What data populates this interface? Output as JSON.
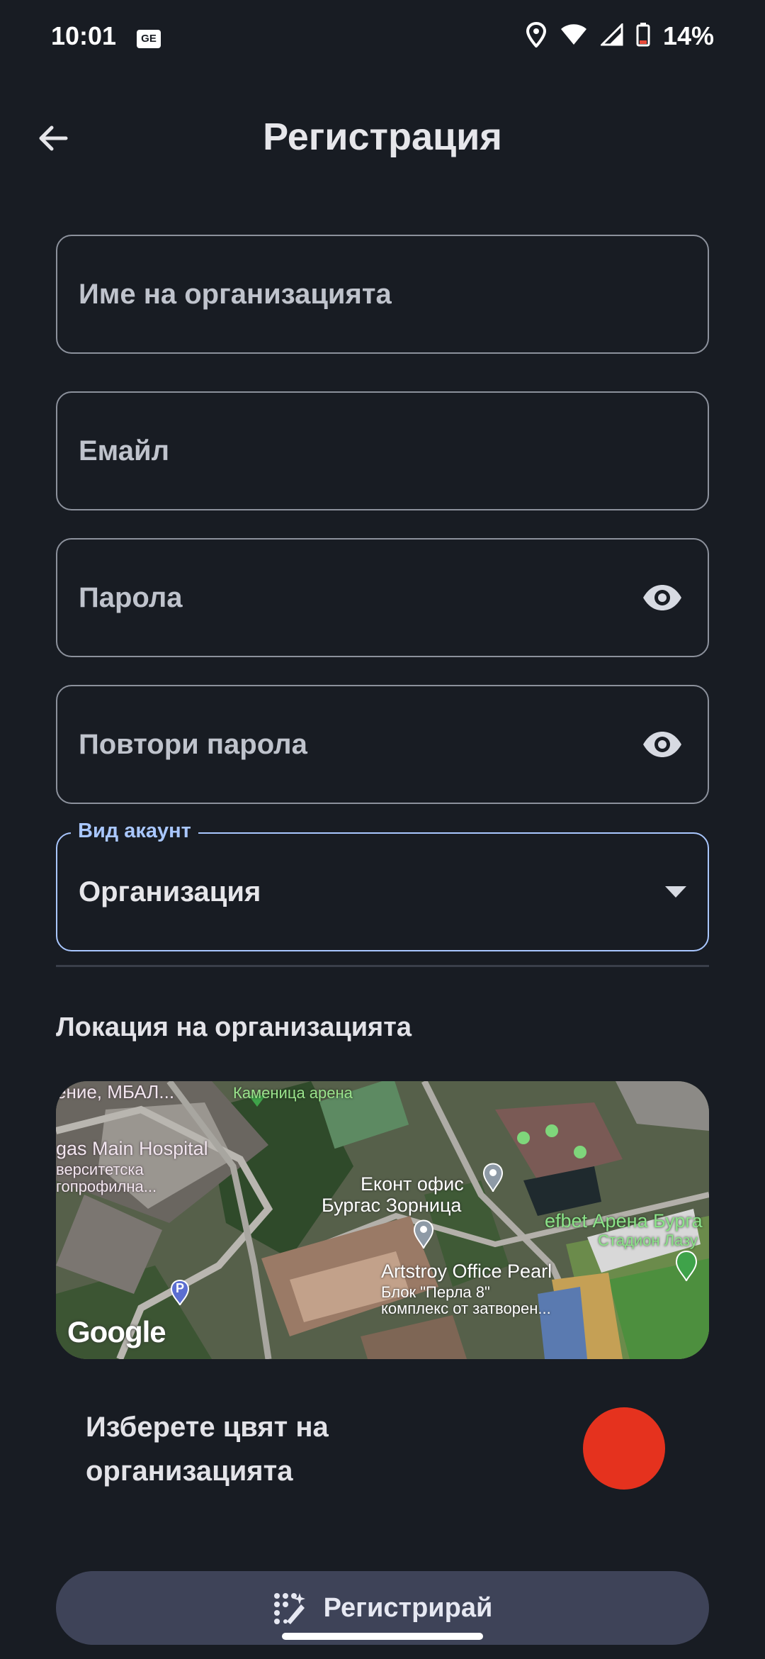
{
  "status_bar": {
    "time": "10:01",
    "ge_badge": "GE",
    "battery_percent": "14%",
    "icons": [
      "location-icon",
      "wifi-icon",
      "signal-icon",
      "battery-icon"
    ]
  },
  "header": {
    "title": "Регистрация",
    "back_icon": "arrow-left-icon"
  },
  "form": {
    "organization_name_placeholder": "Име на организацията",
    "email_placeholder": "Емайл",
    "password_placeholder": "Парола",
    "repeat_password_placeholder": "Повтори парола",
    "account_type_label": "Вид акаунт",
    "account_type_value": "Организация"
  },
  "location": {
    "title": "Локация на организацията",
    "map_labels": {
      "hospital_1": "ение, МБАЛ...",
      "hospital_2": "gas Main Hospital",
      "hospital_3": "верситетска",
      "hospital_4": "гопрофилна...",
      "arena_top": "Каменица арена",
      "econt_1": "Еконт офис",
      "econt_2": "Бургас Зорница",
      "efbet": "efbet Арена Бурга",
      "stadium": "Стадион Лазу",
      "artstroy": "Artstroy Office Pearl",
      "block_1": "Блок \"Перла 8\"",
      "block_2": "комплекс от затворен...",
      "google": "Google",
      "parking": "P"
    }
  },
  "color_picker": {
    "label": "Изберете цвят на организацията",
    "selected_color": "#e5321e"
  },
  "register_button": {
    "label": "Регистрирай"
  },
  "colors": {
    "background": "#181c23",
    "field_border": "#8c919c",
    "focus_accent": "#a9c7ff",
    "button_bg": "#3e4358"
  }
}
